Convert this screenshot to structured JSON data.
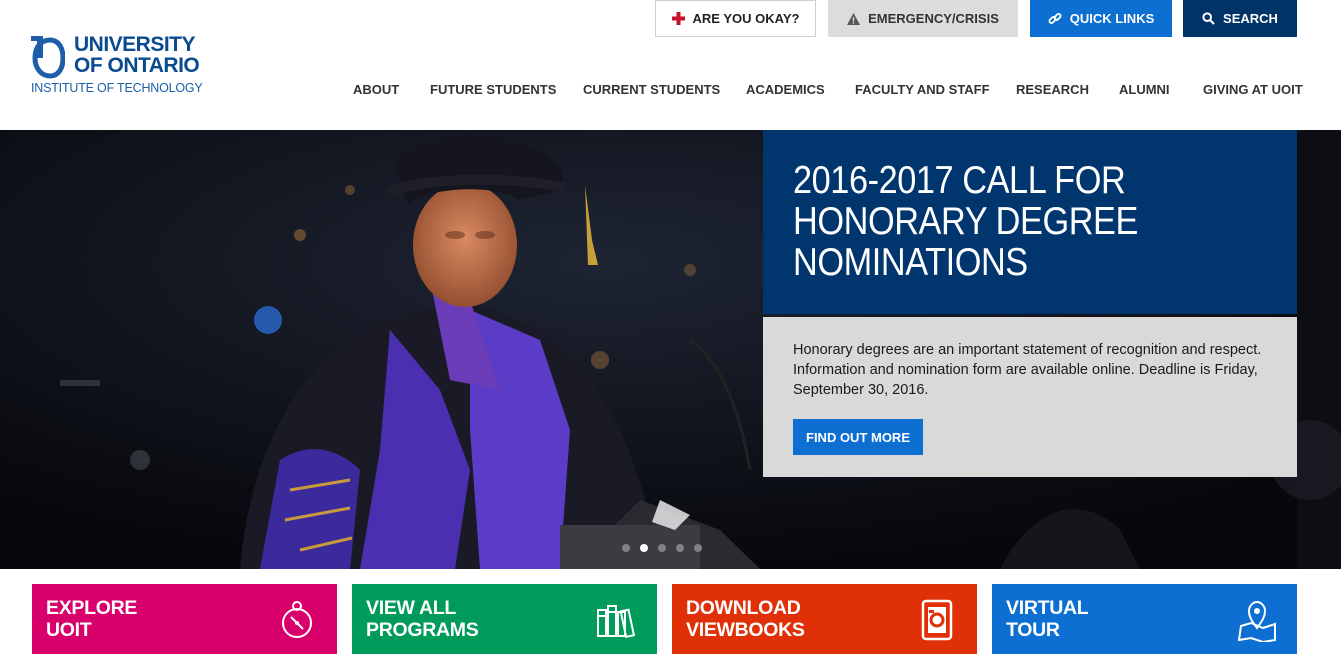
{
  "logo": {
    "line1": "UNIVERSITY",
    "line2": "OF ONTARIO",
    "line3": "INSTITUTE OF TECHNOLOGY"
  },
  "utility": {
    "okay": "ARE YOU OKAY?",
    "emergency": "EMERGENCY/CRISIS",
    "quick_links": "QUICK LINKS",
    "search": "SEARCH"
  },
  "nav": [
    "ABOUT",
    "FUTURE STUDENTS",
    "CURRENT STUDENTS",
    "ACADEMICS",
    "FACULTY AND STAFF",
    "RESEARCH",
    "ALUMNI",
    "GIVING AT UOIT"
  ],
  "hero": {
    "title": "2016-2017 CALL FOR HONORARY DEGREE NOMINATIONS",
    "body": "Honorary degrees are an important statement of recognition and respect. Information and nomination form are available online. Deadline is Friday, September 30, 2016.",
    "button": "FIND OUT MORE",
    "slide_count": 5,
    "active_slide": 2
  },
  "tiles": [
    {
      "label": "EXPLORE\nUOIT",
      "icon": "compass-icon",
      "color": "#d8006b"
    },
    {
      "label": "VIEW ALL\nPROGRAMS",
      "icon": "books-icon",
      "color": "#009a5b"
    },
    {
      "label": "DOWNLOAD\nVIEWBOOKS",
      "icon": "viewbook-icon",
      "color": "#e03008"
    },
    {
      "label": "VIRTUAL\nTOUR",
      "icon": "map-pin-icon",
      "color": "#0d6fd1"
    }
  ],
  "colors": {
    "brand_blue": "#0a4a8f",
    "navy": "#003366",
    "accent_blue": "#0d6fd1",
    "title_box": "#00356e"
  }
}
